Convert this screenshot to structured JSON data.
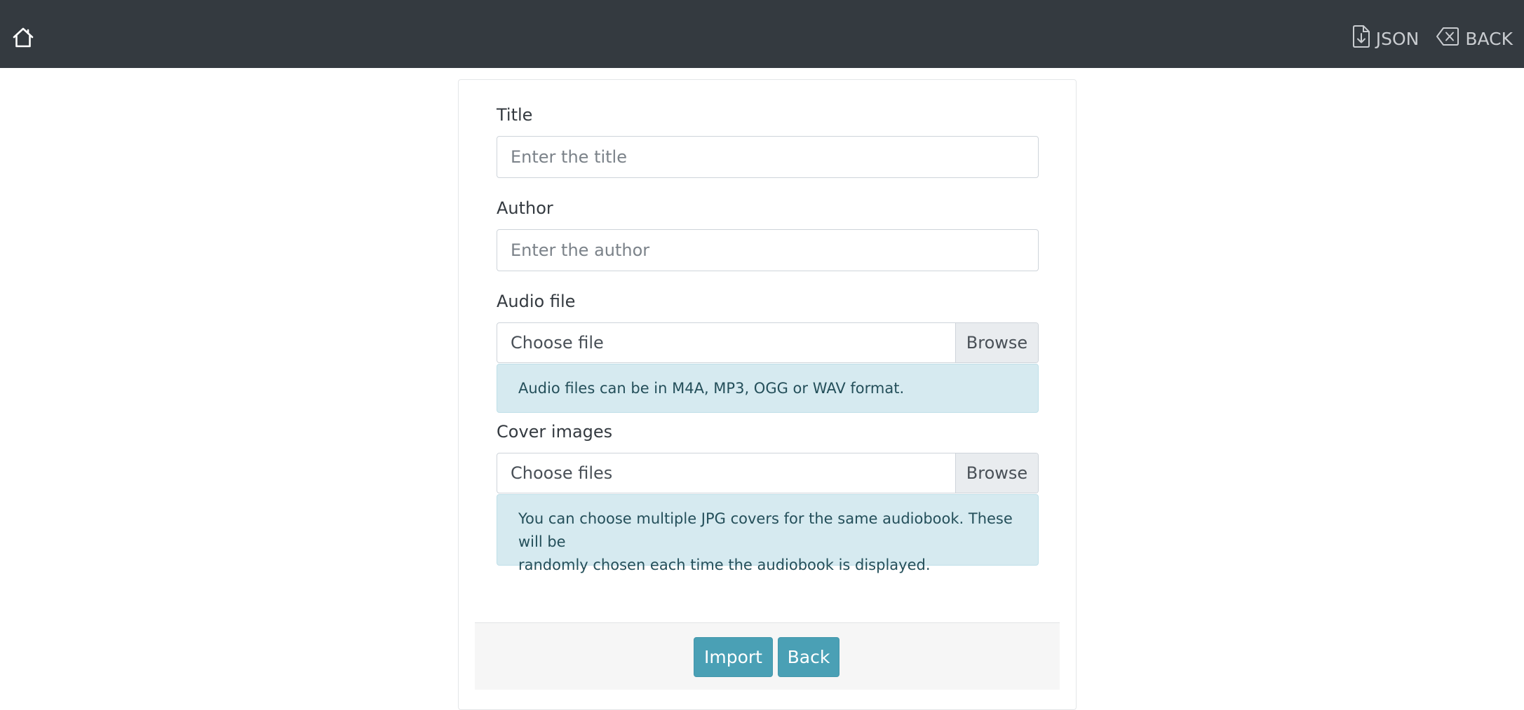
{
  "navbar": {
    "home_icon": "home-icon",
    "json_link": {
      "label": "JSON",
      "icon": "file-download-icon"
    },
    "back_link": {
      "label": "BACK",
      "icon": "backspace-icon"
    },
    "background": "#343a40"
  },
  "form": {
    "title": {
      "label": "Title",
      "placeholder": "Enter the title",
      "value": ""
    },
    "author": {
      "label": "Author",
      "placeholder": "Enter the author",
      "value": ""
    },
    "audio_file": {
      "label": "Audio file",
      "file_text": "Choose file",
      "browse_label": "Browse",
      "hint": "Audio files can be in M4A, MP3, OGG or WAV format."
    },
    "cover_images": {
      "label": "Cover images",
      "file_text": "Choose files",
      "browse_label": "Browse",
      "hint_line1": "You can choose multiple JPG covers for the same audiobook. These will be",
      "hint_line2": "randomly chosen each time the audiobook is displayed."
    }
  },
  "footer": {
    "import_label": "Import",
    "back_label": "Back",
    "button_color": "#4aa0b5"
  },
  "colors": {
    "alert_background": "#d6eaf0",
    "alert_text": "#244f5a"
  }
}
